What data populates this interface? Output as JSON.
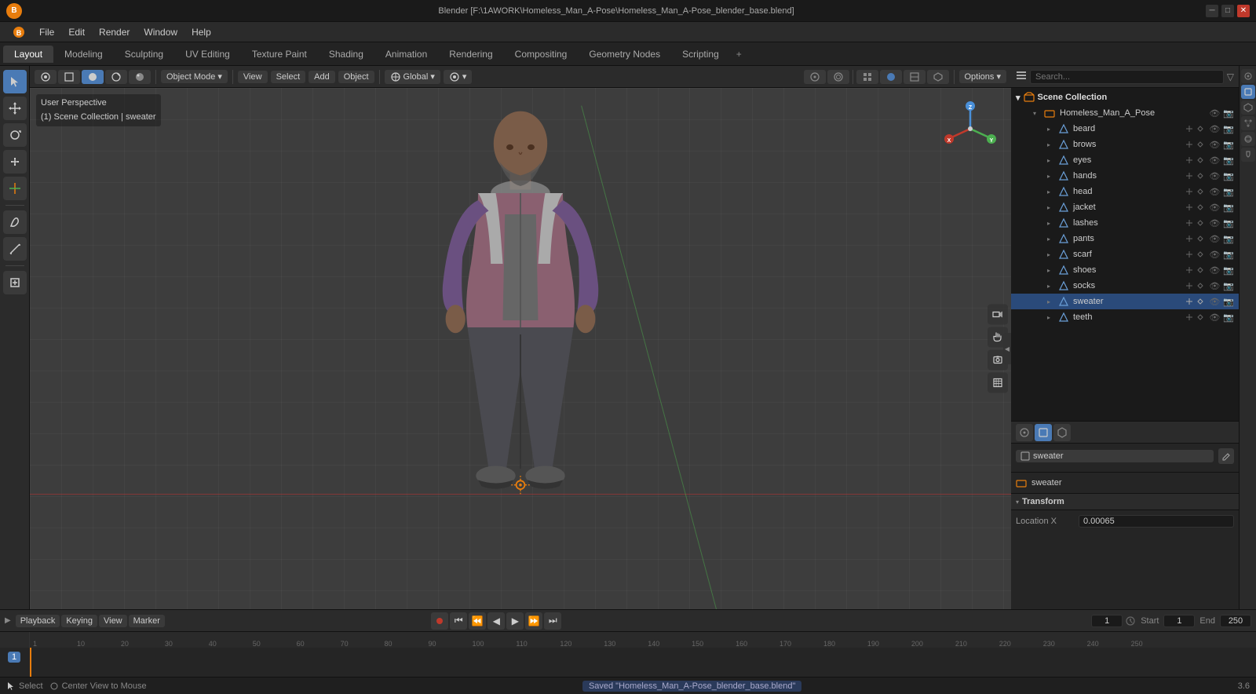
{
  "titlebar": {
    "title": "Blender [F:\\1AWORK\\Homeless_Man_A-Pose\\Homeless_Man_A-Pose_blender_base.blend]",
    "logo": "B",
    "win_minimize": "─",
    "win_maximize": "□",
    "win_close": "✕"
  },
  "menubar": {
    "items": [
      "Blender",
      "File",
      "Edit",
      "Render",
      "Window",
      "Help"
    ]
  },
  "topbar": {
    "tabs": [
      "Layout",
      "Modeling",
      "Sculpting",
      "UV Editing",
      "Texture Paint",
      "Shading",
      "Animation",
      "Rendering",
      "Compositing",
      "Geometry Nodes",
      "Scripting"
    ],
    "active": "Layout"
  },
  "viewport": {
    "mode": "Object Mode",
    "perspective": "User Perspective",
    "collection": "(1) Scene Collection | sweater",
    "global": "Global",
    "view_label": "View",
    "select_label": "Select",
    "add_label": "Add",
    "object_label": "Object"
  },
  "outliner": {
    "title": "Scene Collection",
    "collection_root": "Homeless_Man_A_Pose",
    "items": [
      {
        "name": "beard",
        "type": "mesh"
      },
      {
        "name": "brows",
        "type": "mesh"
      },
      {
        "name": "eyes",
        "type": "mesh"
      },
      {
        "name": "hands",
        "type": "mesh"
      },
      {
        "name": "head",
        "type": "mesh"
      },
      {
        "name": "jacket",
        "type": "mesh"
      },
      {
        "name": "lashes",
        "type": "mesh"
      },
      {
        "name": "pants",
        "type": "mesh"
      },
      {
        "name": "scarf",
        "type": "mesh"
      },
      {
        "name": "shoes",
        "type": "mesh"
      },
      {
        "name": "socks",
        "type": "mesh"
      },
      {
        "name": "sweater",
        "type": "mesh",
        "selected": true
      },
      {
        "name": "teeth",
        "type": "mesh"
      }
    ]
  },
  "properties": {
    "object_name": "sweater",
    "collection_name": "sweater",
    "transform_label": "Transform",
    "location_x_label": "Location X",
    "location_x_value": "0.00065"
  },
  "timeline": {
    "frame_current": "1",
    "frame_start": "1",
    "frame_end": "250",
    "start_label": "Start",
    "end_label": "End",
    "ruler_marks": [
      "1",
      "10",
      "20",
      "30",
      "40",
      "50",
      "60",
      "70",
      "80",
      "90",
      "100",
      "110",
      "120",
      "130",
      "140",
      "150",
      "160",
      "170",
      "180",
      "190",
      "200",
      "210",
      "220",
      "230",
      "240",
      "250"
    ],
    "playback_label": "Playback",
    "keying_label": "Keying",
    "view_label": "View",
    "marker_label": "Marker"
  },
  "statusbar": {
    "left": "Select",
    "center_action": "Center View to Mouse",
    "saved_msg": "Saved \"Homeless_Man_A-Pose_blender_base.blend\"",
    "version": "3.6"
  },
  "gizmo": {
    "x_color": "#c0392b",
    "y_color": "#4caf50",
    "z_color": "#4a90d9"
  }
}
